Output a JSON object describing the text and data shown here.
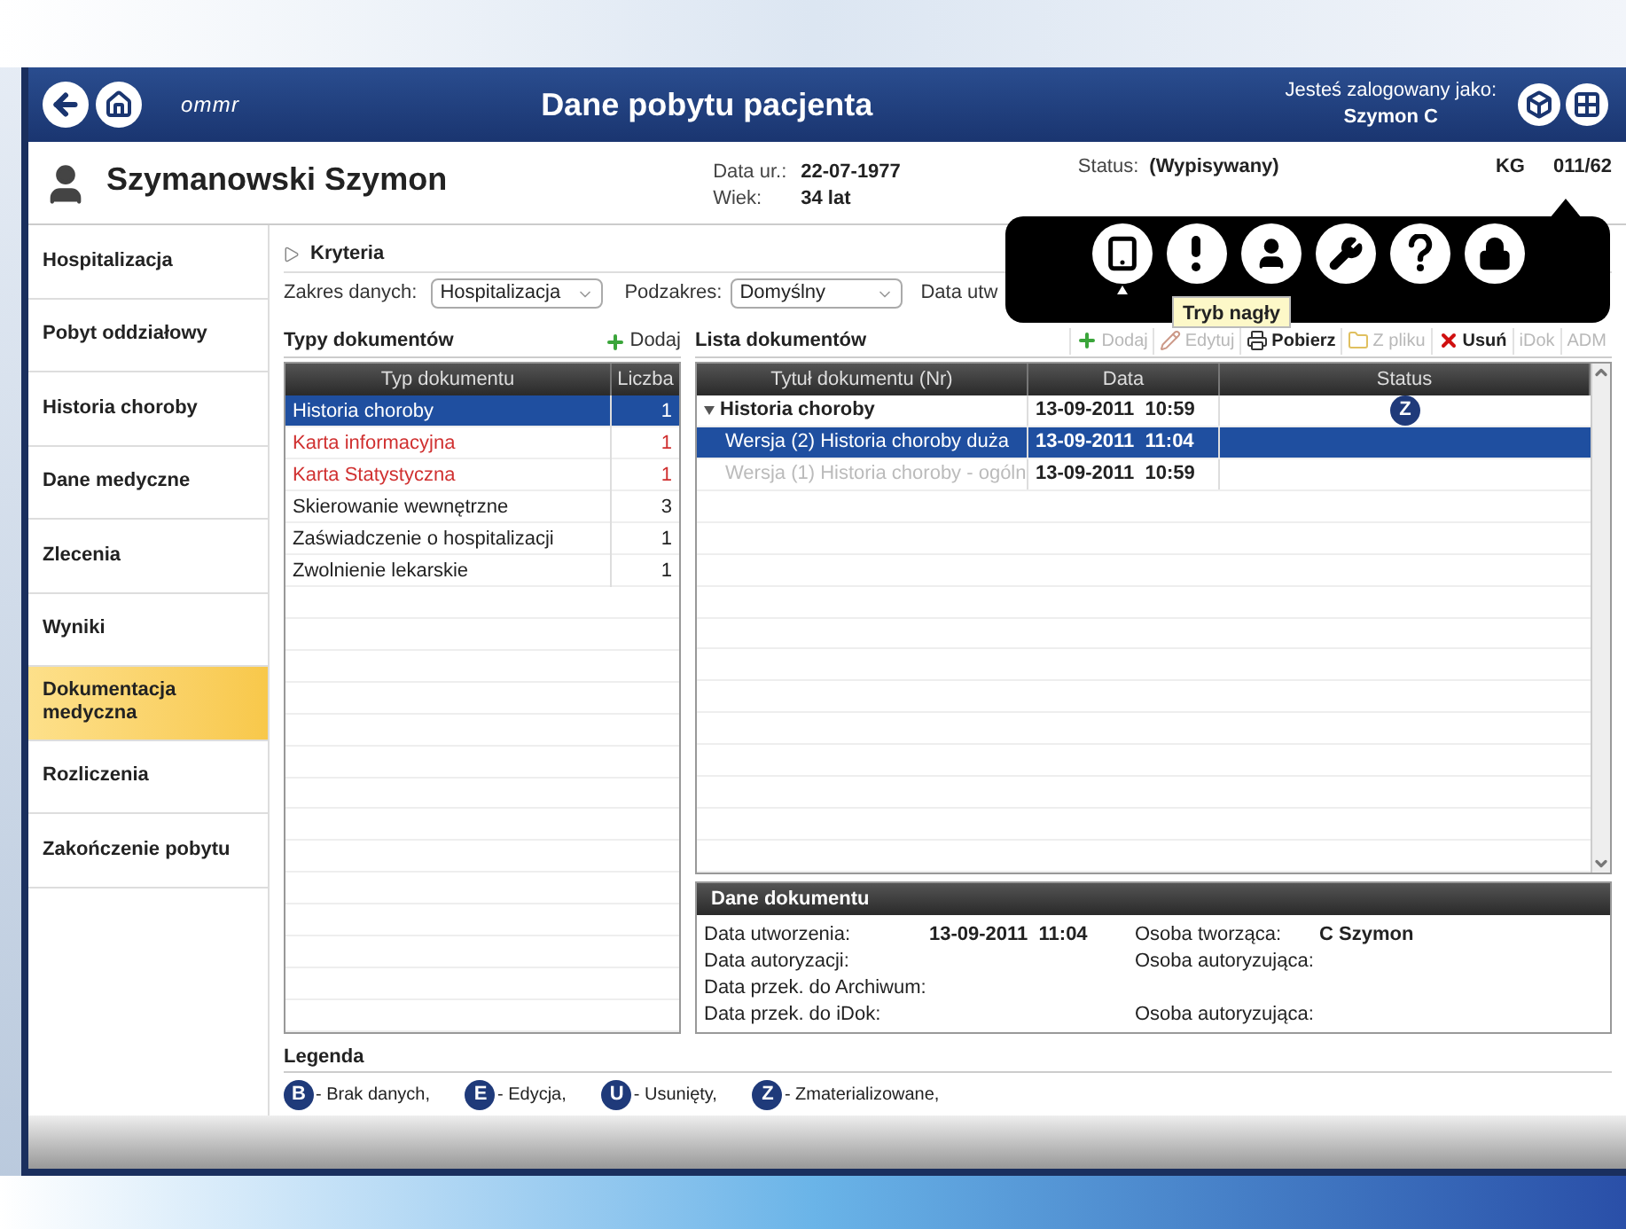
{
  "header": {
    "logo": "ommr",
    "title": "Dane pobytu pacjenta",
    "login_label": "Jesteś zalogowany jako:",
    "user": "Szymon C"
  },
  "patient": {
    "name": "Szymanowski Szymon",
    "birth_label": "Data ur.:",
    "birth": "22-07-1977",
    "age_label": "Wiek:",
    "age": "34 lat",
    "status_label": "Status:",
    "status": "(Wypisywany)",
    "code_start": "KG",
    "code_end": "011/62"
  },
  "sidebar": {
    "items": [
      {
        "label": "Hospitalizacja",
        "selected": false
      },
      {
        "label": "Pobyt oddziałowy",
        "selected": false
      },
      {
        "label": "Historia choroby",
        "selected": false
      },
      {
        "label": "Dane medyczne",
        "selected": false
      },
      {
        "label": "Zlecenia",
        "selected": false
      },
      {
        "label": "Wyniki",
        "selected": false
      },
      {
        "label": "Dokumentacja medyczna",
        "selected": true
      },
      {
        "label": "Rozliczenia",
        "selected": false
      },
      {
        "label": "Zakończenie pobytu",
        "selected": false
      }
    ]
  },
  "criteria": {
    "title": "Kryteria",
    "range_label": "Zakres danych:",
    "range": "Hospitalizacja",
    "subrange_label": "Podzakres:",
    "subrange": "Domyślny",
    "date_label": "Data utw"
  },
  "types": {
    "title": "Typy dokumentów",
    "add": "Dodaj",
    "columns": [
      "Typ dokumentu",
      "Liczba"
    ],
    "rows": [
      {
        "name": "Historia choroby",
        "count": "1",
        "selected": true,
        "alert": false
      },
      {
        "name": "Karta informacyjna",
        "count": "1",
        "selected": false,
        "alert": true
      },
      {
        "name": "Karta Statystyczna",
        "count": "1",
        "selected": false,
        "alert": true
      },
      {
        "name": "Skierowanie wewnętrzne",
        "count": "3",
        "selected": false,
        "alert": false
      },
      {
        "name": "Zaświadczenie o hospitalizacji",
        "count": "1",
        "selected": false,
        "alert": false
      },
      {
        "name": "Zwolnienie lekarskie",
        "count": "1",
        "selected": false,
        "alert": false
      }
    ]
  },
  "documents": {
    "title": "Lista dokumentów",
    "tools": [
      {
        "kind": "add",
        "label": "Dodaj",
        "disabled": true
      },
      {
        "kind": "edit",
        "label": "Edytuj",
        "disabled": true
      },
      {
        "kind": "download",
        "label": "Pobierz",
        "disabled": false
      },
      {
        "kind": "file",
        "label": "Z pliku",
        "disabled": true
      },
      {
        "kind": "delete",
        "label": "Usuń",
        "disabled": false
      },
      {
        "kind": "text",
        "label": "iDok",
        "disabled": true
      },
      {
        "kind": "text",
        "label": "ADM",
        "disabled": true
      }
    ],
    "columns": [
      "Tytuł dokumentu (Nr)",
      "Data",
      "Status"
    ],
    "rows": [
      {
        "title": "Historia choroby",
        "date": "13-09-2011  10:59",
        "status": "Z",
        "expanded": true,
        "selected": false,
        "disabled": false,
        "children": [
          {
            "title": "Wersja (2) Historia choroby duża",
            "date": "13-09-2011  11:04",
            "selected": true,
            "disabled": false
          },
          {
            "title": "Wersja (1) Historia choroby - ogóln",
            "date": "13-09-2011  10:59",
            "selected": false,
            "disabled": true
          }
        ]
      }
    ]
  },
  "details": {
    "title": "Dane dokumentu",
    "rows": [
      {
        "label": "Data utworzenia:",
        "value": "13-09-2011  11:04",
        "label2": "Osoba tworząca:",
        "value2": "C Szymon"
      },
      {
        "label": "Data autoryzacji:",
        "label2": "Osoba autoryzująca:"
      },
      {
        "label": "Data przek. do Archiwum:"
      },
      {
        "label": "Data przek. do iDok:",
        "label2": "Osoba autoryzująca:"
      }
    ]
  },
  "legend": {
    "title": "Legenda",
    "items": [
      {
        "letter": "B",
        "text": "- Brak danych,"
      },
      {
        "letter": "E",
        "text": "- Edycja,"
      },
      {
        "letter": "U",
        "text": "- Usunięty,"
      },
      {
        "letter": "Z",
        "text": "- Zmaterializowane,"
      }
    ]
  },
  "popup": {
    "items": [
      {
        "kind": "tablet",
        "selected": true
      },
      {
        "kind": "alert",
        "selected": false
      },
      {
        "kind": "user",
        "selected": false
      },
      {
        "kind": "wrench",
        "selected": false
      },
      {
        "kind": "help",
        "selected": false
      },
      {
        "kind": "lock",
        "selected": false
      }
    ],
    "tooltip": "Tryb nagły"
  }
}
